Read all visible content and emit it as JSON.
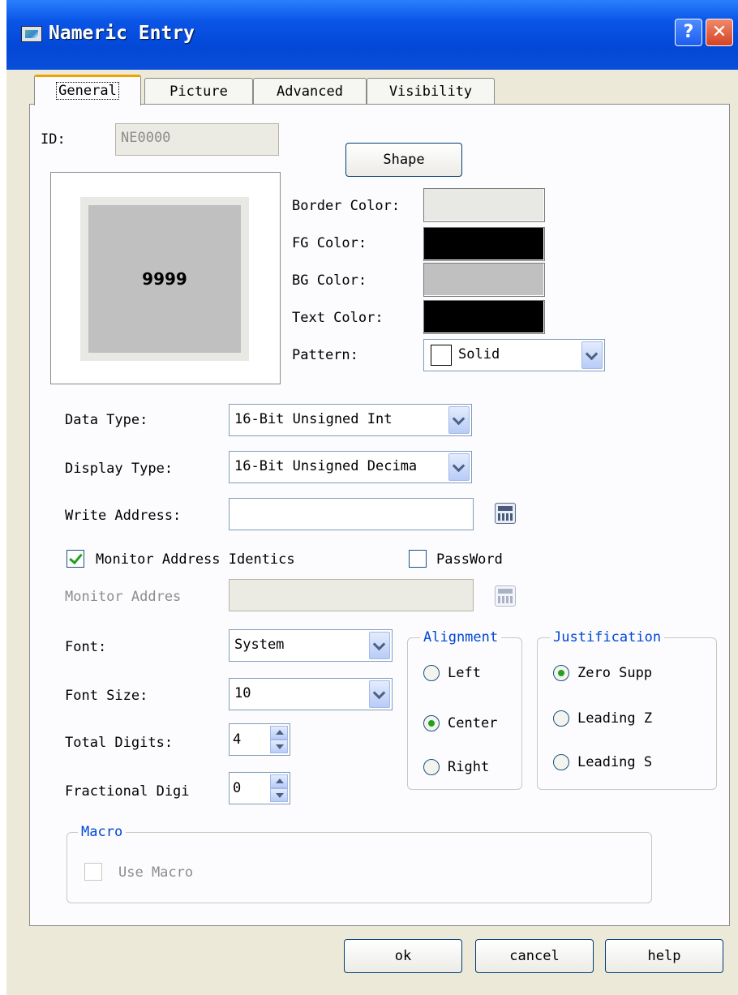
{
  "window": {
    "title": "Nameric Entry"
  },
  "tabs": [
    {
      "label": "General",
      "active": true
    },
    {
      "label": "Picture",
      "active": false
    },
    {
      "label": "Advanced",
      "active": false
    },
    {
      "label": "Visibility",
      "active": false
    }
  ],
  "general": {
    "id_label": "ID:",
    "id_value": "NE0000",
    "shape_button": "Shape",
    "preview_value": "9999",
    "border_color_label": "Border Color:",
    "fg_color_label": "FG Color:",
    "bg_color_label": "BG Color:",
    "text_color_label": "Text Color:",
    "pattern_label": "Pattern:",
    "pattern_value": "Solid",
    "colors": {
      "border": "#e8e8e4",
      "fg": "#000000",
      "bg": "#c0c0c0",
      "text": "#000000"
    },
    "data_type_label": "Data Type:",
    "data_type_value": "16-Bit Unsigned Int",
    "display_type_label": "Display Type:",
    "display_type_value": "16-Bit Unsigned Decima",
    "write_address_label": "Write Address:",
    "write_address_value": "",
    "monitor_identical_label": "Monitor Address Identics",
    "monitor_identical_checked": true,
    "password_label": "PassWord",
    "password_checked": false,
    "monitor_address_label": "Monitor Addres",
    "monitor_address_value": "",
    "font_label": "Font:",
    "font_value": "System",
    "font_size_label": "Font Size:",
    "font_size_value": "10",
    "total_digits_label": "Total Digits:",
    "total_digits_value": "4",
    "fractional_digits_label": "Fractional Digi",
    "fractional_digits_value": "0"
  },
  "alignment": {
    "title": "Alignment",
    "options": [
      "Left",
      "Center",
      "Right"
    ],
    "selected": "Center"
  },
  "justification": {
    "title": "Justification",
    "options": [
      "Zero Supp",
      "Leading Z",
      "Leading S"
    ],
    "selected": "Zero Supp"
  },
  "macro": {
    "title": "Macro",
    "use_macro_label": "Use Macro",
    "use_macro_checked": false
  },
  "footer": {
    "ok": "ok",
    "cancel": "cancel",
    "help": "help"
  }
}
